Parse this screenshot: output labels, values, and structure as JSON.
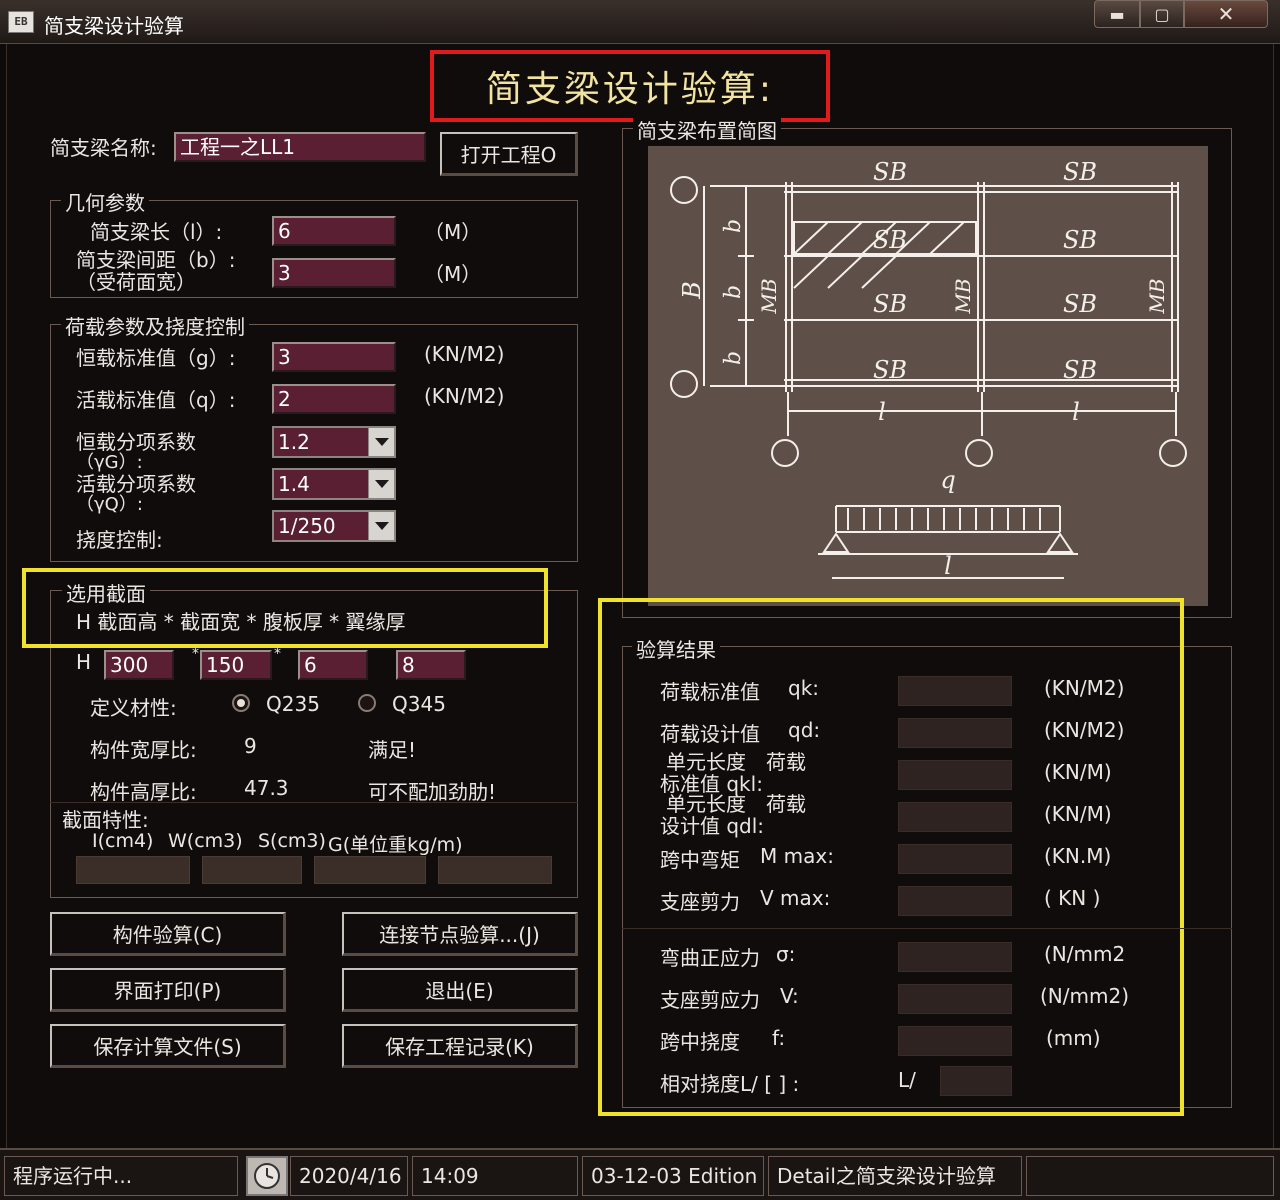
{
  "window": {
    "title": "简支梁设计验算",
    "icon_text": "EB"
  },
  "headline": "简支梁设计验算:",
  "project": {
    "label": "简支梁名称:",
    "value": "工程一之LL1",
    "open_button": "打开工程O"
  },
  "geometry": {
    "title": "几何参数",
    "length_label": "简支梁长（l）:",
    "length_value": "6",
    "length_unit": "（M）",
    "spacing_label1": "简支梁间距（b）:",
    "spacing_label2": "（受荷面宽）",
    "spacing_value": "3",
    "spacing_unit": "（M）"
  },
  "load": {
    "title": "荷载参数及挠度控制",
    "dead_label": "恒载标准值（g）:",
    "dead_value": "3",
    "dead_unit": "(KN/M2)",
    "live_label": "活载标准值（q）:",
    "live_value": "2",
    "live_unit": "(KN/M2)",
    "gammaG_label1": "恒载分项系数",
    "gammaG_label2": "（γG）:",
    "gammaG_value": "1.2",
    "gammaQ_label1": "活载分项系数",
    "gammaQ_label2": "（γQ）:",
    "gammaQ_value": "1.4",
    "deflection_label": "挠度控制:",
    "deflection_value": "1/250"
  },
  "section": {
    "title": "选用截面",
    "header": "H 截面高 * 截面宽 * 腹板厚 * 翼缘厚",
    "h_prefix": "H",
    "height": "300",
    "width": "150",
    "web": "6",
    "flange": "8",
    "sep": "*",
    "material_label": "定义材性:",
    "material_q235": "Q235",
    "material_q345": "Q345",
    "width_thick_label": "构件宽厚比:",
    "width_thick_value": "9",
    "width_thick_status": "满足!",
    "height_thick_label": "构件高厚比:",
    "height_thick_value": "47.3",
    "height_thick_status": "可不配加劲肋!",
    "props_label": "截面特性:",
    "props_cols": [
      "I(cm4)",
      "W(cm3)",
      "S(cm3)",
      "G(单位重kg/m)"
    ]
  },
  "buttons": {
    "check_member": "构件验算(C)",
    "check_joint": "连接节点验算...(J)",
    "print": "界面打印(P)",
    "exit": "退出(E)",
    "save_calc": "保存计算文件(S)",
    "save_record": "保存工程记录(K)"
  },
  "diagram": {
    "title": "简支梁布置简图",
    "sb": "SB",
    "mb": "MB",
    "b": "b",
    "B": "B",
    "l": "l",
    "q": "q"
  },
  "results": {
    "title": "验算结果",
    "rows": [
      {
        "label": "荷载标准值",
        "sym": "qk:",
        "unit": "(KN/M2)"
      },
      {
        "label": "荷载设计值",
        "sym": "qd:",
        "unit": "(KN/M2)"
      },
      {
        "label": "单元长度　荷载",
        "label2": "标准值 qkl:",
        "unit": "(KN/M)"
      },
      {
        "label": "单元长度　荷载",
        "label2": "设计值 qdl:",
        "unit": "(KN/M)"
      },
      {
        "label": "跨中弯矩",
        "sym": "M max:",
        "unit": "(KN.M)"
      },
      {
        "label": "支座剪力",
        "sym": "V max:",
        "unit": "( KN )"
      },
      {
        "label": "弯曲正应力",
        "sym": "σ:",
        "unit": "(N/mm2)"
      },
      {
        "label": "支座剪应力",
        "sym": "V:",
        "unit": "(N/mm2)"
      },
      {
        "label": "跨中挠度",
        "sym": "f:",
        "unit": "(mm)"
      }
    ],
    "rel_deflection_label": "相对挠度L/ [ ] :",
    "rel_deflection_prefix": "L/"
  },
  "status": {
    "state": "程序运行中...",
    "date": "2020/4/16",
    "time": "14:09",
    "edition": "03-12-03 Edition",
    "detail": "Detail之简支梁设计验算"
  },
  "colors": {
    "highlight_red": "#e01b1b",
    "highlight_yellow": "#f0e12a",
    "field_bg": "#5a1f33"
  }
}
